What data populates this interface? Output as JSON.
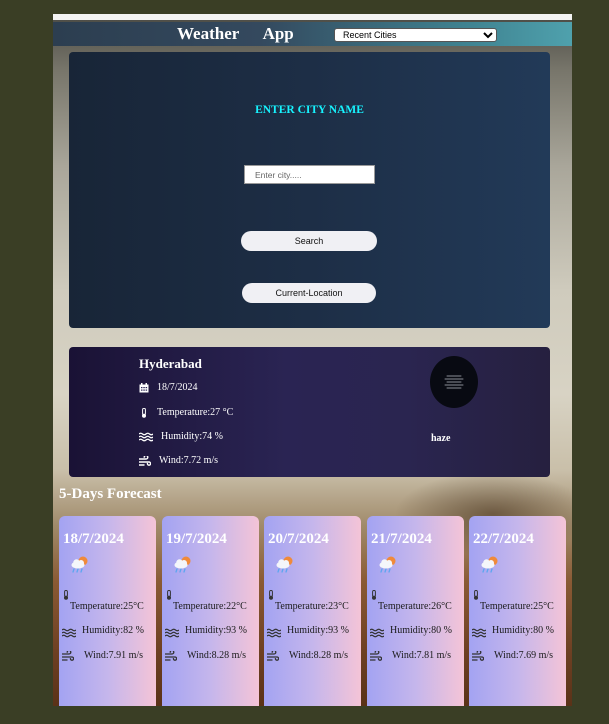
{
  "header": {
    "title": "Weather  App",
    "recent_select": "Recent Cities"
  },
  "search": {
    "heading": "ENTER CITY NAME",
    "input_placeholder": "Enter city.....",
    "input_value": "",
    "search_label": "Search",
    "location_label": "Current-Location"
  },
  "current": {
    "city": "Hyderabad",
    "date": "18/7/2024",
    "temperature": "Temperature:27 °C",
    "humidity": "Humidity:74 %",
    "wind": "Wind:7.72 m/s",
    "condition": "haze",
    "condition_icon": "haze-icon"
  },
  "forecast": {
    "title": "5-Days Forecast",
    "days": [
      {
        "date": "18/7/2024",
        "icon": "rain-cloud-sun-icon",
        "temperature": "Temperature:25°C",
        "humidity": "Humidity:82 %",
        "wind": "Wind:7.91 m/s"
      },
      {
        "date": "19/7/2024",
        "icon": "rain-cloud-sun-icon",
        "temperature": "Temperature:22°C",
        "humidity": "Humidity:93 %",
        "wind": "Wind:8.28 m/s"
      },
      {
        "date": "20/7/2024",
        "icon": "rain-cloud-sun-icon",
        "temperature": "Temperature:23°C",
        "humidity": "Humidity:93 %",
        "wind": "Wind:8.28 m/s"
      },
      {
        "date": "21/7/2024",
        "icon": "rain-cloud-sun-icon",
        "temperature": "Temperature:26°C",
        "humidity": "Humidity:80 %",
        "wind": "Wind:7.81 m/s"
      },
      {
        "date": "22/7/2024",
        "icon": "rain-cloud-sun-icon",
        "temperature": "Temperature:25°C",
        "humidity": "Humidity:80 %",
        "wind": "Wind:7.69 m/s"
      }
    ]
  },
  "colors": {
    "heading_accent": "#17f3ff",
    "card_gradient_start": "#a3a3f2",
    "card_gradient_end": "#f4c4d7",
    "page_background": "#3a3e25"
  }
}
